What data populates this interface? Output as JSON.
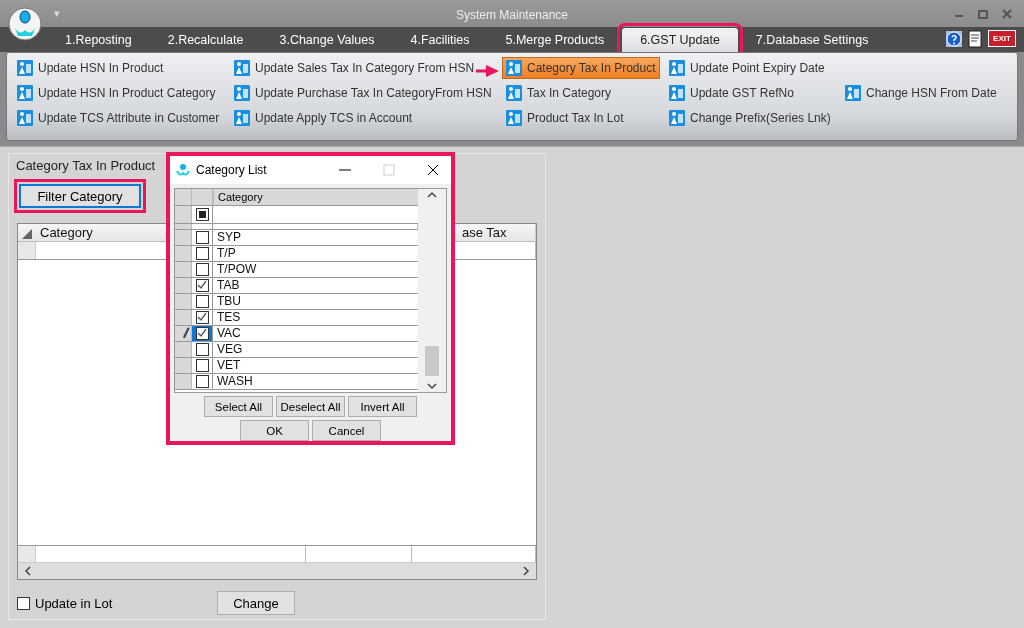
{
  "window": {
    "title": "System Maintenance",
    "menu_caret": "▾",
    "exit_label": "EXIT"
  },
  "tabs": [
    {
      "label": "1.Reposting",
      "selected": false,
      "highlighted": false
    },
    {
      "label": "2.Recalculate",
      "selected": false,
      "highlighted": false
    },
    {
      "label": "3.Change Values",
      "selected": false,
      "highlighted": false
    },
    {
      "label": "4.Facilities",
      "selected": false,
      "highlighted": false
    },
    {
      "label": "5.Merge Products",
      "selected": false,
      "highlighted": false
    },
    {
      "label": "6.GST Update",
      "selected": true,
      "highlighted": true
    },
    {
      "label": "7.Database Settings",
      "selected": false,
      "highlighted": false
    }
  ],
  "ribbon": {
    "rows": [
      [
        {
          "label": "Update HSN In Product",
          "selected": false
        },
        {
          "label": "Update Sales Tax In Category From HSN",
          "selected": false
        },
        {
          "label": "Category Tax In Product",
          "selected": true
        },
        {
          "label": "Update Point Expiry Date",
          "selected": false
        }
      ],
      [
        {
          "label": "Update HSN In Product Category",
          "selected": false
        },
        {
          "label": "Update Purchase Tax In CategoryFrom HSN",
          "selected": false
        },
        {
          "label": "Tax In Category",
          "selected": false
        },
        {
          "label": "Update GST RefNo",
          "selected": false
        },
        {
          "label": "Change HSN From Date",
          "selected": false
        }
      ],
      [
        {
          "label": "Update TCS Attribute in Customer",
          "selected": false
        },
        {
          "label": "Update Apply TCS in Account",
          "selected": false
        },
        {
          "label": "Product Tax In Lot",
          "selected": false
        },
        {
          "label": "Change Prefix(Series Lnk)",
          "selected": false
        }
      ]
    ]
  },
  "panel": {
    "title": "Category Tax In Product",
    "filter_button": {
      "label": "Filter Category",
      "highlighted": true
    },
    "grid": {
      "columns": [
        {
          "header": "Category"
        },
        {
          "header": "ase Tax"
        }
      ]
    },
    "update_in_lot": {
      "label": "Update in Lot",
      "checked": false
    },
    "change_button": "Change"
  },
  "dialog": {
    "title": "Category List",
    "highlighted": true,
    "column": "Category",
    "select_all_indeterminate": true,
    "rows": [
      {
        "name": "SYP",
        "checked": false,
        "current": false
      },
      {
        "name": "T/P",
        "checked": false,
        "current": false
      },
      {
        "name": "T/POW",
        "checked": false,
        "current": false
      },
      {
        "name": "TAB",
        "checked": true,
        "current": false
      },
      {
        "name": "TBU",
        "checked": false,
        "current": false
      },
      {
        "name": "TES",
        "checked": true,
        "current": false
      },
      {
        "name": "VAC",
        "checked": true,
        "current": true
      },
      {
        "name": "VEG",
        "checked": false,
        "current": false
      },
      {
        "name": "VET",
        "checked": false,
        "current": false
      },
      {
        "name": "WASH",
        "checked": false,
        "current": false
      }
    ],
    "buttons": [
      "Select All",
      "Deselect All",
      "Invert All"
    ],
    "ok": "OK",
    "cancel": "Cancel"
  }
}
